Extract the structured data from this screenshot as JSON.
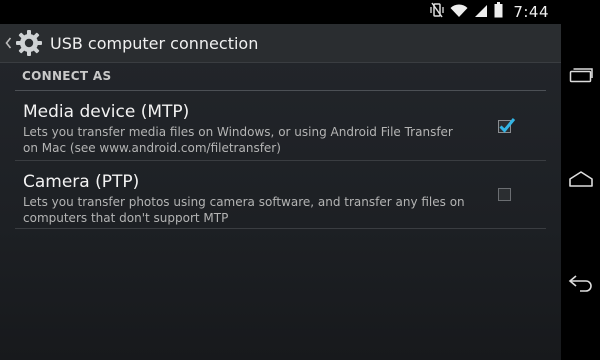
{
  "status_bar": {
    "time": "7:44",
    "icons": [
      "vibrate-icon",
      "wifi-icon",
      "signal-icon",
      "battery-icon"
    ]
  },
  "action_bar": {
    "title": "USB computer connection",
    "app_icon": "gear-icon",
    "up_icon": "chevron-left-icon"
  },
  "category": {
    "label": "CONNECT AS"
  },
  "options": [
    {
      "title": "Media device (MTP)",
      "summary_line1": "Lets you transfer media files on Windows, or using Android File Transfer",
      "summary_line2": "on Mac (see www.android.com/filetransfer)",
      "checked": true
    },
    {
      "title": "Camera (PTP)",
      "summary_line1": "Lets you transfer photos using camera software, and transfer any files on",
      "summary_line2": "computers that don't support MTP",
      "checked": false
    }
  ],
  "navigation": {
    "buttons": [
      "recents-icon",
      "home-icon",
      "back-icon"
    ]
  },
  "colors": {
    "accent": "#33b5e5",
    "background": "#1d2024",
    "text_primary": "#f2f2f2",
    "text_secondary": "#b4b4b4"
  }
}
